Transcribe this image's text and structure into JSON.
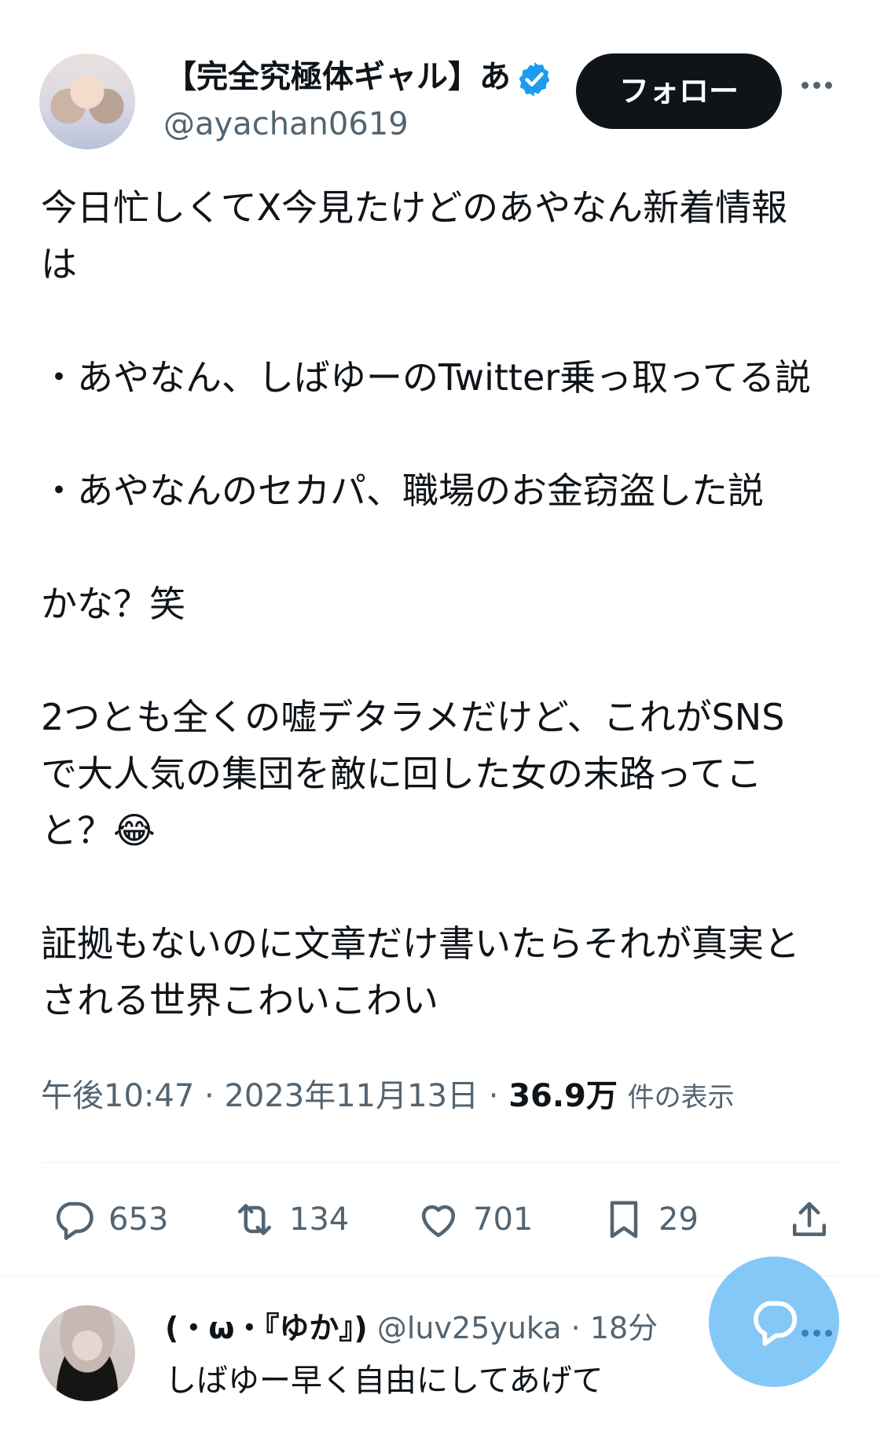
{
  "author": {
    "display_name": "【完全究極体ギャル】あ",
    "handle": "@ayachan0619",
    "follow_label": "フォロー"
  },
  "tweet": {
    "text": "今日忙しくてX今見たけどのあやなん新着情報\nは\n\n・あやなん、しばゆーのTwitter乗っ取ってる説\n\n・あやなんのセカパ、職場のお金窃盗した説\n\nかな？笑\n\n2つとも全くの嘘デタラメだけど、これがSNS\nで大人気の集団を敵に回した女の末路ってこ\nと？😂\n\n証拠もないのに文章だけ書いたらそれが真実と\nされる世界こわいこわい",
    "time": "午後10:47",
    "date": "2023年11月13日",
    "views_count": "36.9万",
    "views_label": "件の表示"
  },
  "actions": {
    "replies": "653",
    "retweets": "134",
    "likes": "701",
    "bookmarks": "29"
  },
  "reply": {
    "display_name": "(・ω・『ゆか』)",
    "handle": "@luv25yuka",
    "time": "18分",
    "text": "しばゆー早く自由にしてあげて"
  },
  "colors": {
    "accent": "#1d9bf0",
    "text": "#0f1419",
    "secondary": "#536471"
  }
}
